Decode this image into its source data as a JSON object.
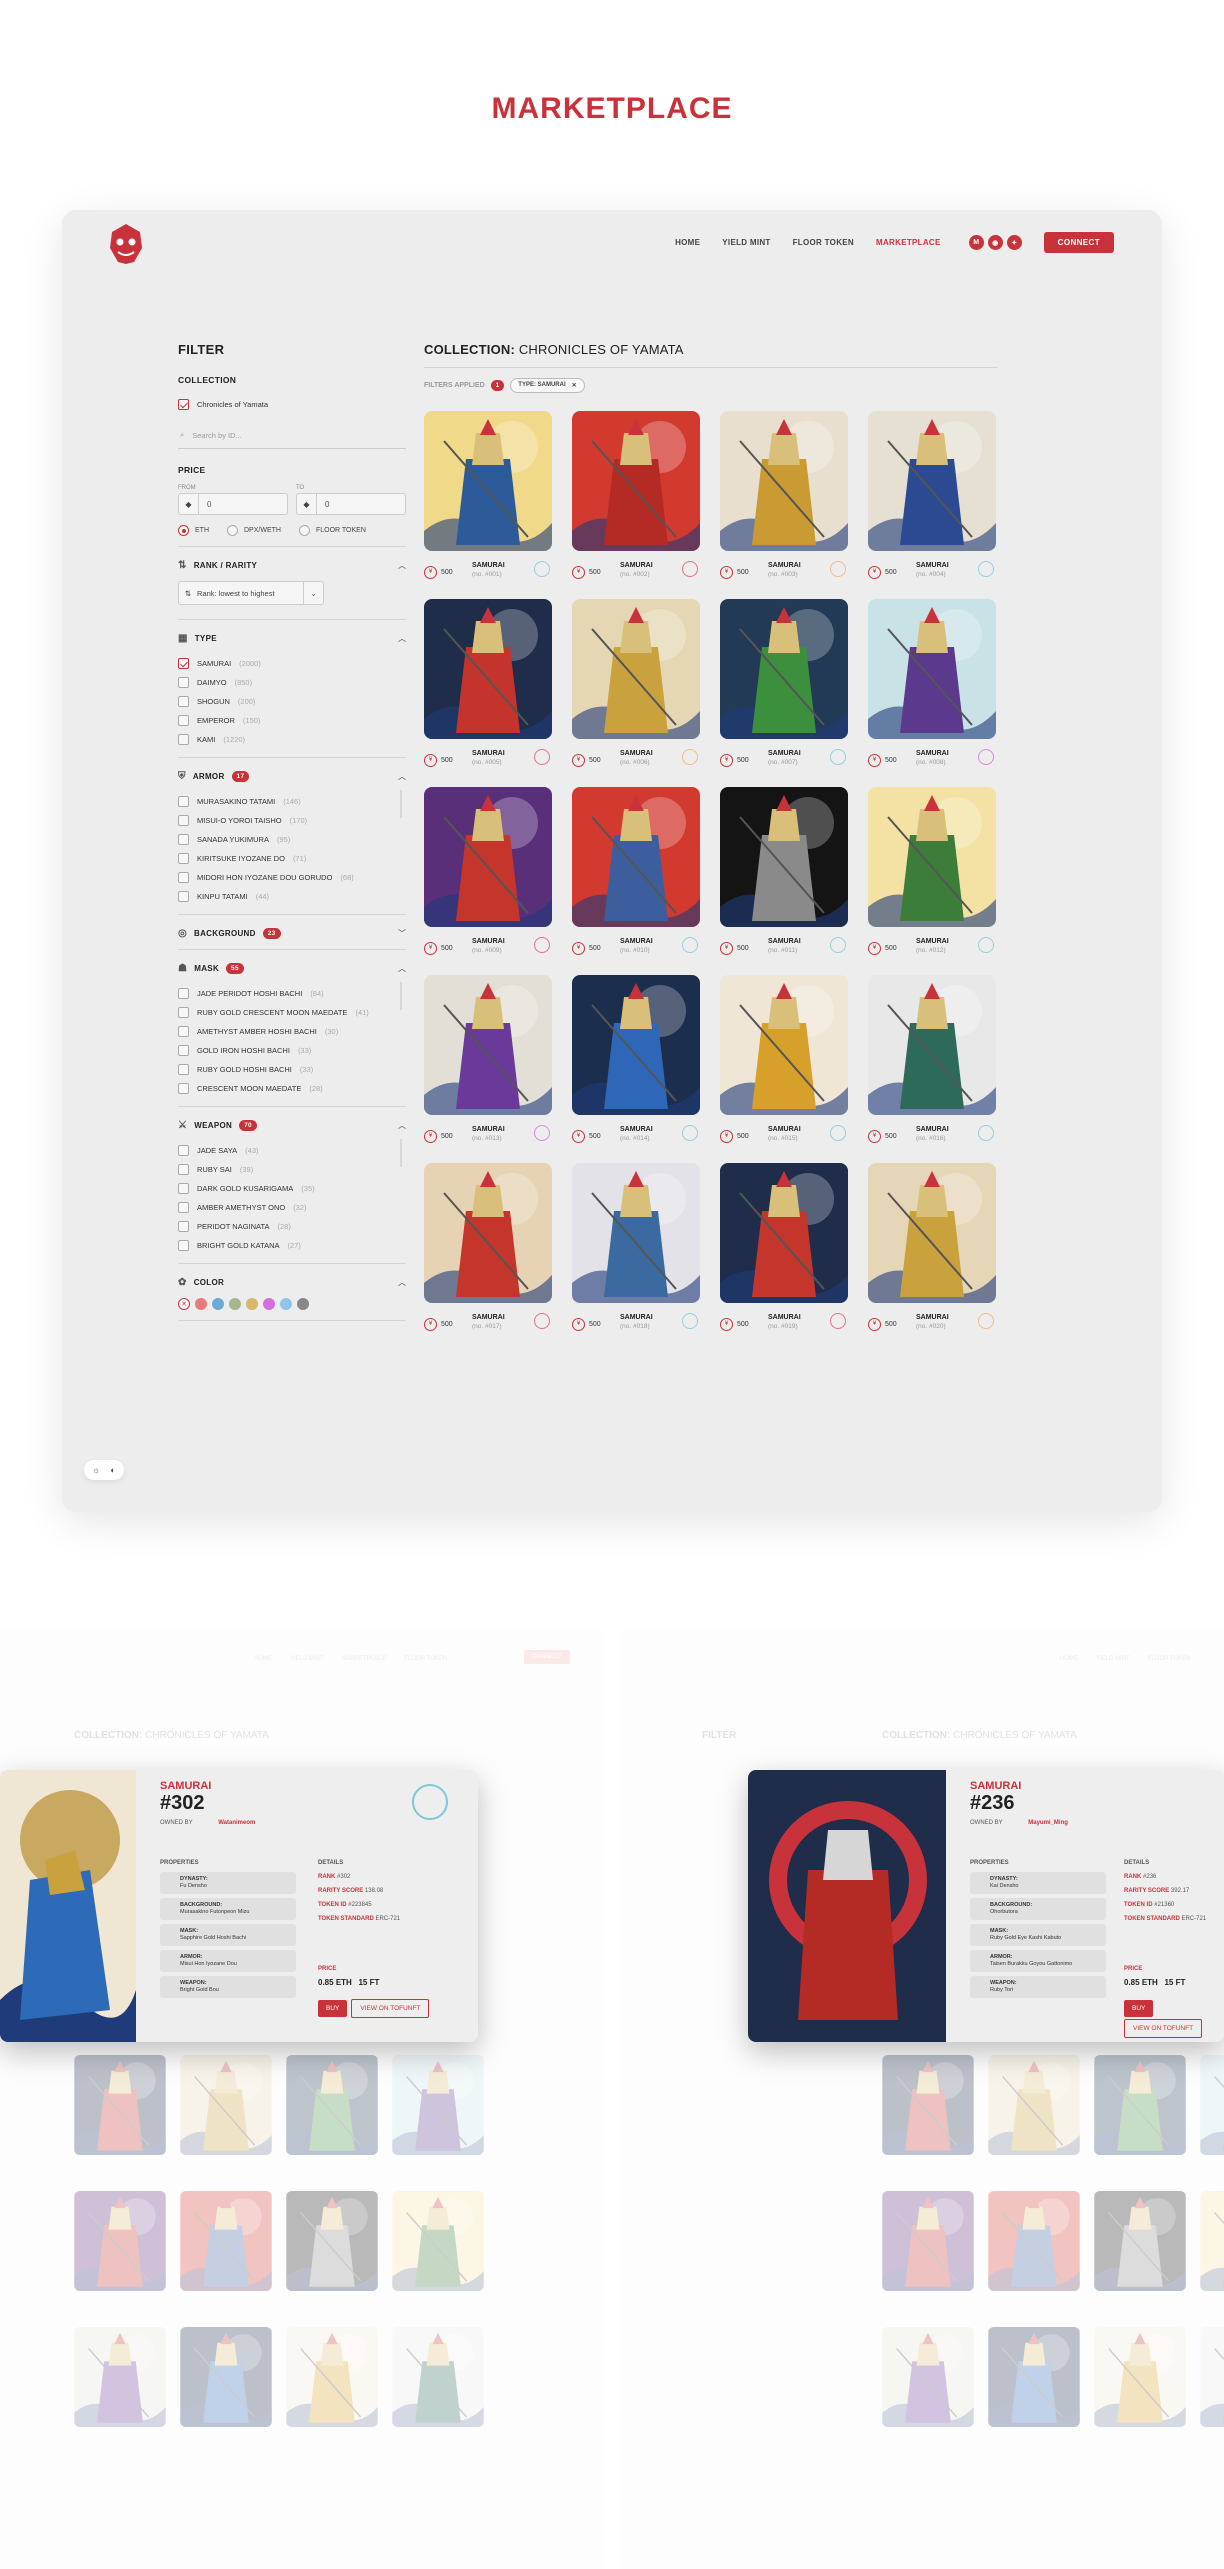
{
  "page": {
    "title": "MARKETPLACE"
  },
  "nav": {
    "items": [
      "HOME",
      "YIELD MINT",
      "FLOOR TOKEN",
      "MARKETPLACE"
    ],
    "active": "MARKETPLACE",
    "connect": "CONNECT",
    "socials": [
      "medium-icon",
      "discord-icon",
      "twitter-icon"
    ]
  },
  "filter": {
    "title": "FILTER",
    "collection_label": "COLLECTION",
    "collection_option": "Chronicles of Yamata",
    "search_placeholder": "Search by ID...",
    "price_label": "PRICE",
    "from_label": "FROM",
    "to_label": "TO",
    "from_value": "0",
    "to_value": "0",
    "currencies": [
      "ETH",
      "DPX/WETH",
      "FLOOR TOKEN"
    ],
    "rank_label": "RANK / RARITY",
    "sort_value": "Rank: lowest to highest",
    "type_label": "TYPE",
    "types": [
      {
        "name": "SAMURAI",
        "count": "(2000)",
        "checked": true
      },
      {
        "name": "DAIMYO",
        "count": "(850)",
        "checked": false
      },
      {
        "name": "SHOGUN",
        "count": "(200)",
        "checked": false
      },
      {
        "name": "EMPEROR",
        "count": "(150)",
        "checked": false
      },
      {
        "name": "KAMI",
        "count": "(1220)",
        "checked": false
      }
    ],
    "armor_label": "ARMOR",
    "armor_count": "17",
    "armor": [
      {
        "name": "MURASAKINO TATAMI",
        "count": "(146)"
      },
      {
        "name": "MISUI-O YOROI TAISHO",
        "count": "(170)"
      },
      {
        "name": "SANADA YUKIMURA",
        "count": "(95)"
      },
      {
        "name": "KIRITSUKE IYOZANE DO",
        "count": "(71)"
      },
      {
        "name": "MIDORI HON IYOZANE DOU GORUDO",
        "count": "(68)"
      },
      {
        "name": "KINPU TATAMI",
        "count": "(44)"
      }
    ],
    "background_label": "BACKGROUND",
    "background_count": "23",
    "mask_label": "MASK",
    "mask_count": "55",
    "mask": [
      {
        "name": "JADE PERIDOT HOSHI BACHI",
        "count": "(84)"
      },
      {
        "name": "RUBY GOLD CRESCENT MOON MAEDATE",
        "count": "(41)"
      },
      {
        "name": "AMETHYST AMBER HOSHI BACHI",
        "count": "(30)"
      },
      {
        "name": "GOLD IRON HOSHI BACHI",
        "count": "(33)"
      },
      {
        "name": "RUBY GOLD HOSHI BACHI",
        "count": "(33)"
      },
      {
        "name": "CRESCENT MOON MAEDATE",
        "count": "(28)"
      }
    ],
    "weapon_label": "WEAPON",
    "weapon_count": "70",
    "weapon": [
      {
        "name": "JADE SAYA",
        "count": "(43)"
      },
      {
        "name": "RUBY SAI",
        "count": "(39)"
      },
      {
        "name": "DARK GOLD KUSARIGAMA",
        "count": "(35)"
      },
      {
        "name": "AMBER AMETHYST ONO",
        "count": "(32)"
      },
      {
        "name": "PERIDOT NAGINATA",
        "count": "(28)"
      },
      {
        "name": "BRIGHT GOLD KATANA",
        "count": "(27)"
      }
    ],
    "color_label": "COLOR",
    "colors": [
      "#e87a7a",
      "#6ea9d6",
      "#a6b58c",
      "#d6b86a",
      "#d36ee0",
      "#8fc6e8",
      "#888888"
    ]
  },
  "main": {
    "collection_prefix": "COLLECTION:",
    "collection_name": "CHRONICLES OF YAMATA",
    "filters_applied": "FILTERS APPLIED",
    "filters_count": "1",
    "chip": "TYPE: SAMURAI",
    "cards": [
      {
        "name": "SAMURAI",
        "id": "(no. #001)",
        "price": "500",
        "bg": "#f1d98a",
        "armor": "#2d5b9a",
        "rarity": "#7cc9d9"
      },
      {
        "name": "SAMURAI",
        "id": "(no. #002)",
        "price": "500",
        "bg": "#d23a2f",
        "armor": "#b42a25",
        "rarity": "#e4536a"
      },
      {
        "name": "SAMURAI",
        "id": "(no. #003)",
        "price": "500",
        "bg": "#e8dfcf",
        "armor": "#c99b32",
        "rarity": "#f0b36d"
      },
      {
        "name": "SAMURAI",
        "id": "(no. #004)",
        "price": "500",
        "bg": "#e5e0d2",
        "armor": "#2c4a92",
        "rarity": "#7cc9d9"
      },
      {
        "name": "SAMURAI",
        "id": "(no. #005)",
        "price": "500",
        "bg": "#1f2d4a",
        "armor": "#c2342c",
        "rarity": "#e4536a"
      },
      {
        "name": "SAMURAI",
        "id": "(no. #006)",
        "price": "500",
        "bg": "#e5d7b3",
        "armor": "#c9a23e",
        "rarity": "#f0b36d"
      },
      {
        "name": "SAMURAI",
        "id": "(no. #007)",
        "price": "500",
        "bg": "#223a55",
        "armor": "#3c8f3c",
        "rarity": "#7cc9d9"
      },
      {
        "name": "SAMURAI",
        "id": "(no. #008)",
        "price": "500",
        "bg": "#c8e2e6",
        "armor": "#5b3a8e",
        "rarity": "#d36ee0"
      },
      {
        "name": "SAMURAI",
        "id": "(no. #009)",
        "price": "500",
        "bg": "#5a2f7a",
        "armor": "#c4352c",
        "rarity": "#e4536a"
      },
      {
        "name": "SAMURAI",
        "id": "(no. #010)",
        "price": "500",
        "bg": "#d23a2f",
        "armor": "#3d5e9d",
        "rarity": "#7cc9d9"
      },
      {
        "name": "SAMURAI",
        "id": "(no. #011)",
        "price": "500",
        "bg": "#141414",
        "armor": "#8a8a8a",
        "rarity": "#7cc9d9"
      },
      {
        "name": "SAMURAI",
        "id": "(no. #012)",
        "price": "500",
        "bg": "#f3e2a3",
        "armor": "#3c7d3a",
        "rarity": "#7cc9d9"
      },
      {
        "name": "SAMURAI",
        "id": "(no. #013)",
        "price": "500",
        "bg": "#e2dfd6",
        "armor": "#6a3a9a",
        "rarity": "#d36ee0"
      },
      {
        "name": "SAMURAI",
        "id": "(no. #014)",
        "price": "500",
        "bg": "#1c2e4d",
        "armor": "#2e66b8",
        "rarity": "#7cc9d9"
      },
      {
        "name": "SAMURAI",
        "id": "(no. #015)",
        "price": "500",
        "bg": "#efe6d6",
        "armor": "#d6a02a",
        "rarity": "#7cc9d9"
      },
      {
        "name": "SAMURAI",
        "id": "(no. #016)",
        "price": "500",
        "bg": "#e8e8e8",
        "armor": "#2d6a5a",
        "rarity": "#7cc9d9"
      },
      {
        "name": "SAMURAI",
        "id": "(no. #017)",
        "price": "500",
        "bg": "#e6d3b3",
        "armor": "#c4352c",
        "rarity": "#e4536a"
      },
      {
        "name": "SAMURAI",
        "id": "(no. #018)",
        "price": "500",
        "bg": "#e2e2e8",
        "armor": "#3a6aa0",
        "rarity": "#7cc9d9"
      },
      {
        "name": "SAMURAI",
        "id": "(no. #019)",
        "price": "500",
        "bg": "#1f2d4a",
        "armor": "#c4352c",
        "rarity": "#e4536a"
      },
      {
        "name": "SAMURAI",
        "id": "(no. #020)",
        "price": "500",
        "bg": "#e6d6b8",
        "armor": "#c9a23e",
        "rarity": "#f0b36d"
      }
    ]
  },
  "modal_left": {
    "name": "SAMURAI",
    "number": "#302",
    "owned_by": "OWNED BY",
    "owner": "Watanimeom",
    "properties": "PROPERTIES",
    "details": "DETAILS",
    "props": [
      {
        "k": "DYNASTY:",
        "v": "Fu Densho"
      },
      {
        "k": "BACKGROUND:",
        "v": "Murasakino Futonpeon Mizu"
      },
      {
        "k": "MASK:",
        "v": "Sapphire Gold Hoshi Bachi"
      },
      {
        "k": "ARMOR:",
        "v": "Misui Hon Iyozane Dou"
      },
      {
        "k": "WEAPON:",
        "v": "Bright Gold Bou"
      }
    ],
    "details_list": [
      {
        "k": "RANK",
        "v": "#302"
      },
      {
        "k": "RARITY SCORE",
        "v": "138.08"
      },
      {
        "k": "TOKEN ID",
        "v": "#223845"
      },
      {
        "k": "TOKEN STANDARD",
        "v": "ERC-721"
      }
    ],
    "price_label": "PRICE",
    "price_eth": "0.85",
    "eth": "ETH",
    "price_ft": "15 FT",
    "buy": "BUY",
    "view": "VIEW ON TOFUNFT"
  },
  "modal_right": {
    "name": "SAMURAI",
    "number": "#236",
    "owned_by": "OWNED BY",
    "owner": "Mayumi_Ming",
    "properties": "PROPERTIES",
    "details": "DETAILS",
    "props": [
      {
        "k": "DYNASTY:",
        "v": "Kai Densho"
      },
      {
        "k": "BACKGROUND:",
        "v": "Ohorbutora"
      },
      {
        "k": "MASK:",
        "v": "Ruby Gold Eye Kashi Kabuto"
      },
      {
        "k": "ARMOR:",
        "v": "Taisen Burakku Goyou Gattonimo"
      },
      {
        "k": "WEAPON:",
        "v": "Ruby Tori"
      }
    ],
    "details_list": [
      {
        "k": "RANK",
        "v": "#236"
      },
      {
        "k": "RARITY SCORE",
        "v": "392.17"
      },
      {
        "k": "TOKEN ID",
        "v": "#21360"
      },
      {
        "k": "TOKEN STANDARD",
        "v": "ERC-721"
      }
    ],
    "price_label": "PRICE",
    "price_eth": "0.85",
    "eth": "ETH",
    "price_ft": "15 FT",
    "buy": "BUY",
    "view": "VIEW ON TOFUNFT"
  }
}
